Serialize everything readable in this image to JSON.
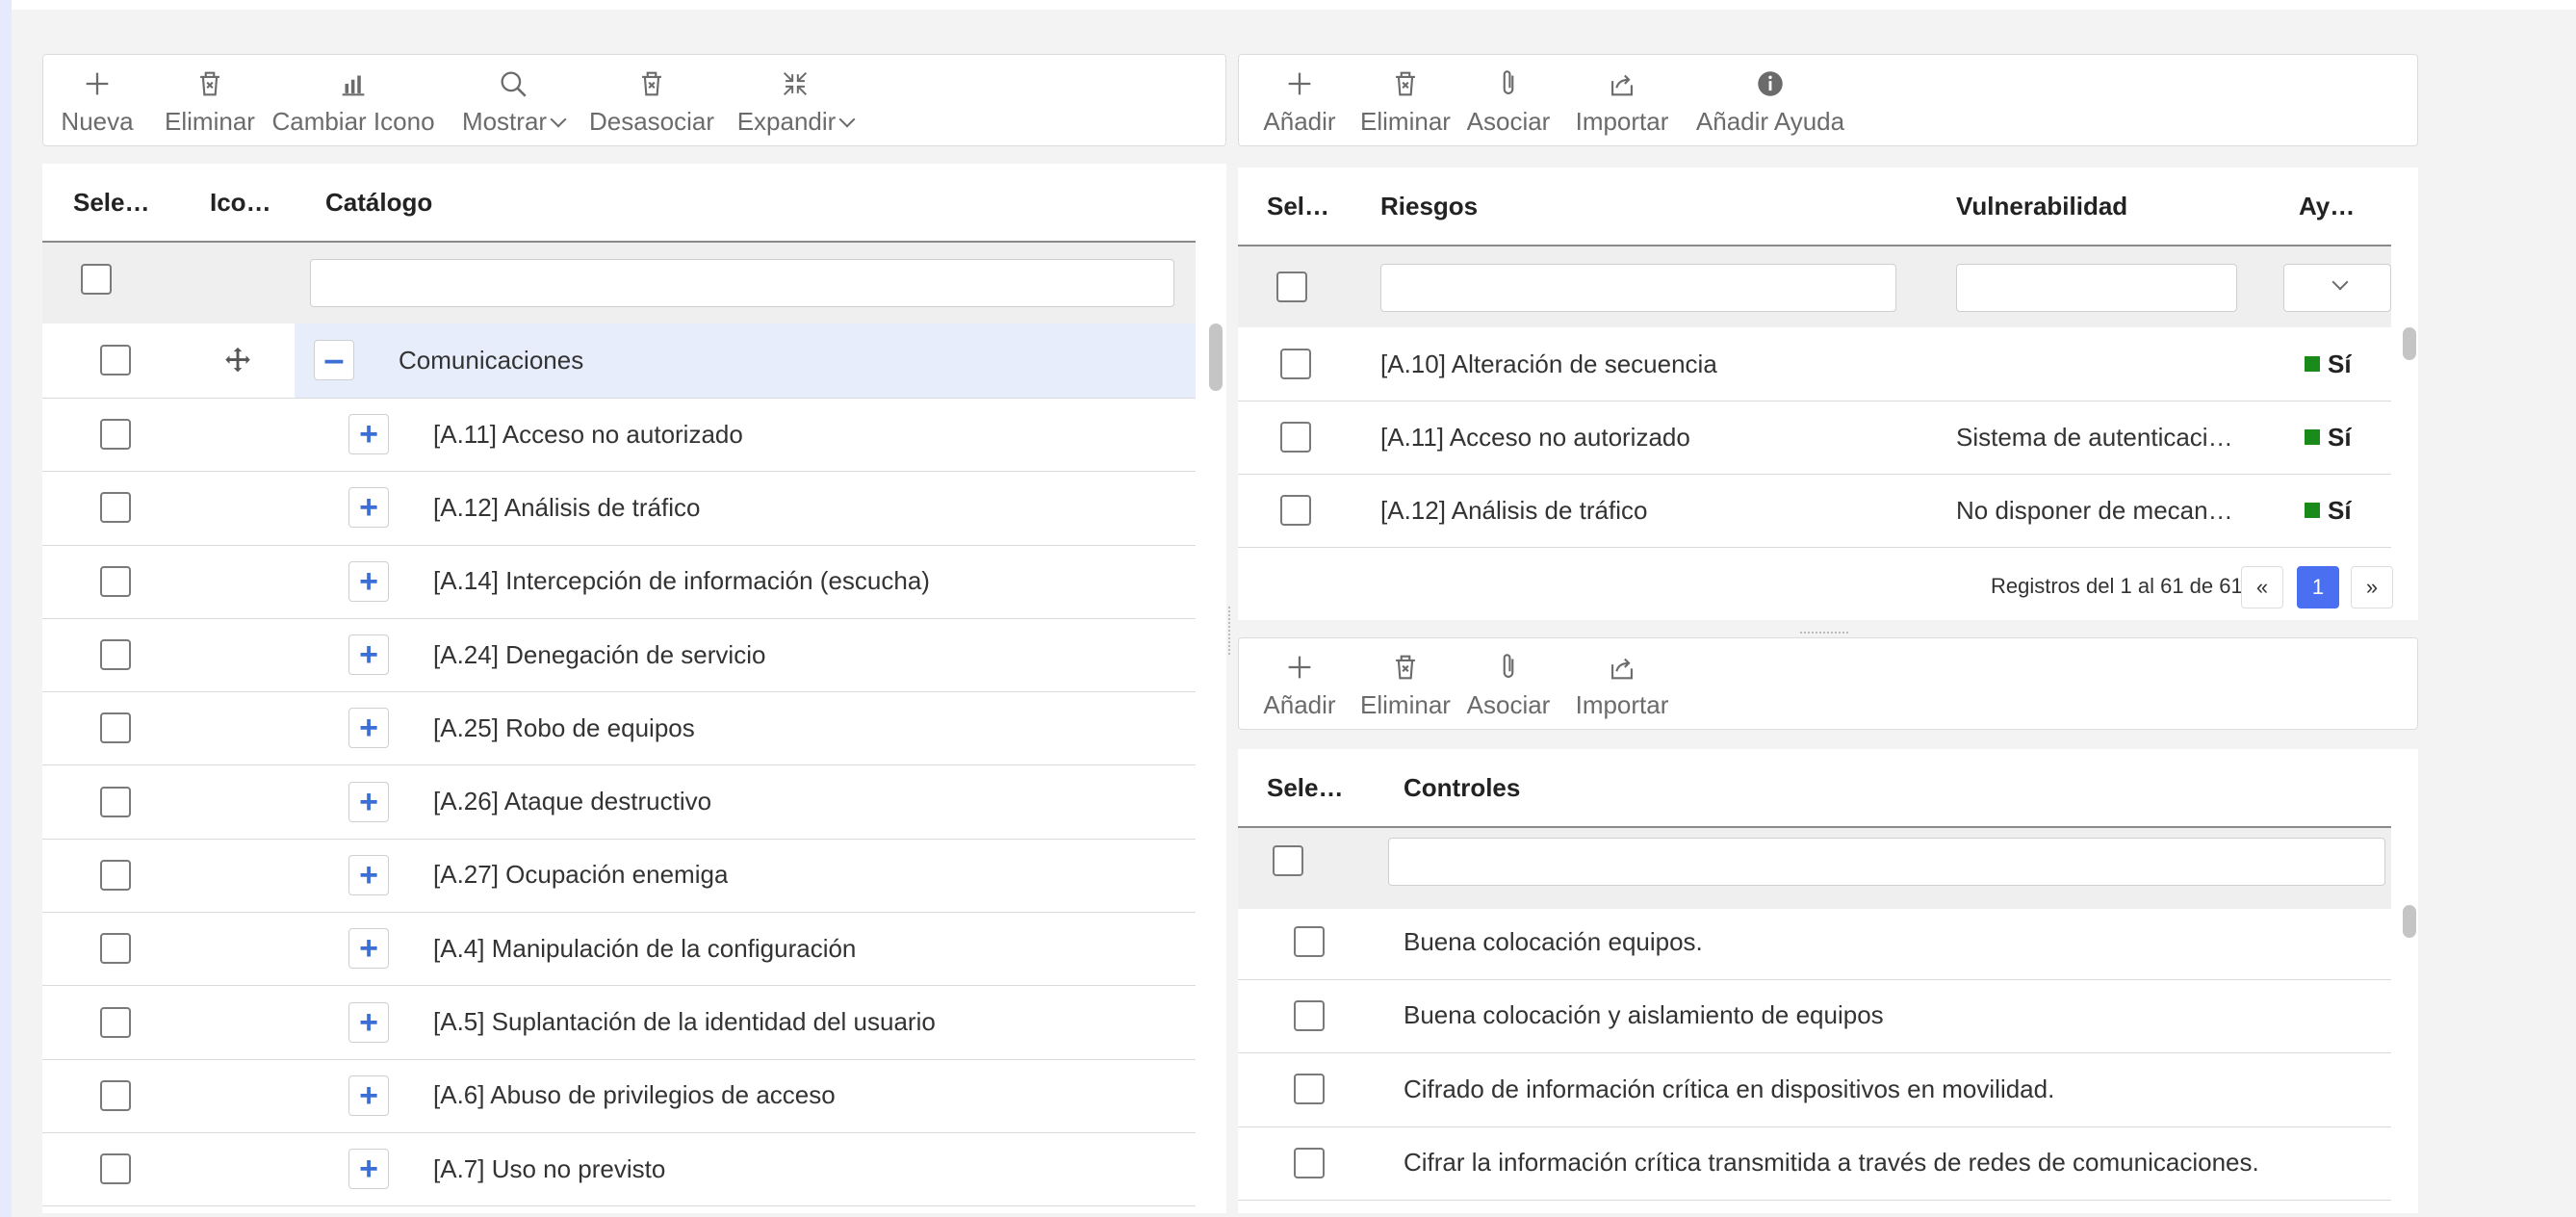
{
  "left_toolbar": {
    "nueva": "Nueva",
    "eliminar": "Eliminar",
    "cambiar_icono": "Cambiar Icono",
    "mostrar": "Mostrar",
    "desasociar": "Desasociar",
    "expandir": "Expandir"
  },
  "catalog": {
    "headers": {
      "select": "Sele…",
      "icon": "Ico…",
      "catalog": "Catálogo"
    },
    "group": "Comunicaciones",
    "rows": [
      "[A.11] Acceso no autorizado",
      "[A.12] Análisis de tráfico",
      "[A.14] Intercepción de información (escucha)",
      "[A.24] Denegación de servicio",
      "[A.25] Robo de equipos",
      "[A.26] Ataque destructivo",
      "[A.27] Ocupación enemiga",
      "[A.4] Manipulación de la configuración",
      "[A.5] Suplantación de la identidad del usuario",
      "[A.6] Abuso de privilegios de acceso",
      "[A.7] Uso no previsto"
    ]
  },
  "risk_toolbar": {
    "anadir": "Añadir",
    "eliminar": "Eliminar",
    "asociar": "Asociar",
    "importar": "Importar",
    "anadir_ayuda": "Añadir Ayuda"
  },
  "risks": {
    "headers": {
      "select": "Sel…",
      "riesgos": "Riesgos",
      "vulnerabilidad": "Vulnerabilidad",
      "ayuda": "Ay…"
    },
    "rows": [
      {
        "riesgo": "[A.10] Alteración de secuencia",
        "vuln": "",
        "ayuda": "Sí"
      },
      {
        "riesgo": "[A.11] Acceso no autorizado",
        "vuln": "Sistema de autenticaci…",
        "ayuda": "Sí"
      },
      {
        "riesgo": "[A.12] Análisis de tráfico",
        "vuln": "No disponer de mecan…",
        "ayuda": "Sí"
      }
    ],
    "pager": {
      "text": "Registros del 1 al 61 de 61",
      "prev": "«",
      "page": "1",
      "next": "»"
    }
  },
  "controls_toolbar": {
    "anadir": "Añadir",
    "eliminar": "Eliminar",
    "asociar": "Asociar",
    "importar": "Importar"
  },
  "controls": {
    "headers": {
      "select": "Sele…",
      "controles": "Controles"
    },
    "rows": [
      "Buena colocación equipos.",
      "Buena colocación y aislamiento de equipos",
      "Cifrado de información crítica en dispositivos en movilidad.",
      "Cifrar la información crítica transmitida a través de redes de comunicaciones."
    ]
  },
  "colors": {
    "accent": "#4a6ff0",
    "plus": "#3b6fd6",
    "yes": "#1a8a1a",
    "selected_row": "#e8edfc"
  }
}
